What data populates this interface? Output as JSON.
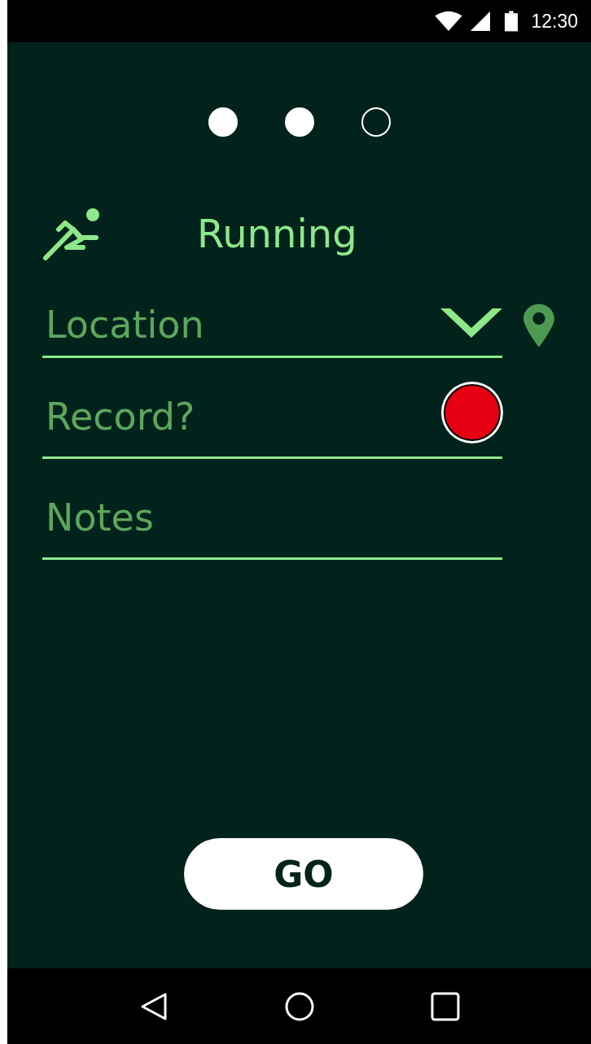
{
  "status_bar": {
    "time": "12:30"
  },
  "pager": [
    {
      "selected": true
    },
    {
      "selected": true
    },
    {
      "selected": false
    }
  ],
  "activity": {
    "title": "Running"
  },
  "fields": [
    {
      "kind": "dropdown",
      "placeholder": "Location"
    },
    {
      "kind": "record",
      "placeholder": "Record?"
    },
    {
      "kind": "text",
      "placeholder": "Notes"
    }
  ],
  "go_button": {
    "label": "GO"
  }
}
